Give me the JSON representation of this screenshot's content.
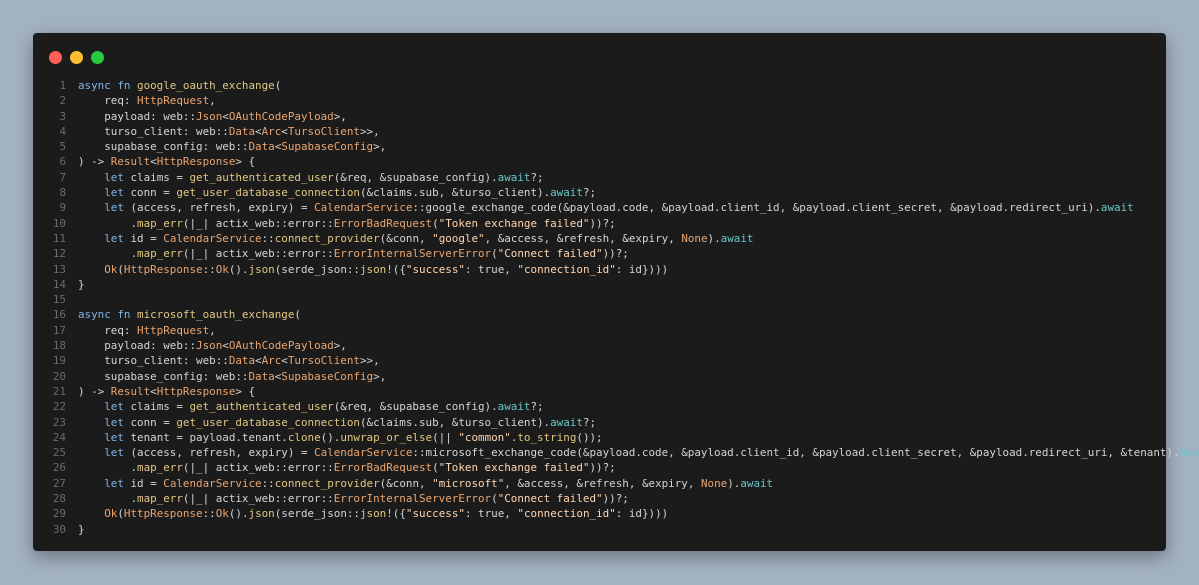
{
  "window": {
    "controls": [
      {
        "name": "close",
        "color": "#ff5f56"
      },
      {
        "name": "minimize",
        "color": "#ffbd2e"
      },
      {
        "name": "maximize",
        "color": "#27c93f"
      }
    ]
  },
  "code": {
    "lines": [
      {
        "n": "1",
        "t": [
          [
            "kw",
            "async fn "
          ],
          [
            "fn",
            "google_oauth_exchange"
          ],
          [
            "pl",
            "("
          ]
        ]
      },
      {
        "n": "2",
        "t": [
          [
            "pl",
            "    req: "
          ],
          [
            "ty",
            "HttpRequest"
          ],
          [
            "pl",
            ","
          ]
        ]
      },
      {
        "n": "3",
        "t": [
          [
            "pl",
            "    payload: web::"
          ],
          [
            "ty",
            "Json"
          ],
          [
            "pl",
            "<"
          ],
          [
            "ty",
            "OAuthCodePayload"
          ],
          [
            "pl",
            ">,"
          ]
        ]
      },
      {
        "n": "4",
        "t": [
          [
            "pl",
            "    turso_client: web::"
          ],
          [
            "ty",
            "Data"
          ],
          [
            "pl",
            "<"
          ],
          [
            "ty",
            "Arc"
          ],
          [
            "pl",
            "<"
          ],
          [
            "ty",
            "TursoClient"
          ],
          [
            "pl",
            ">>,"
          ]
        ]
      },
      {
        "n": "5",
        "t": [
          [
            "pl",
            "    supabase_config: web::"
          ],
          [
            "ty",
            "Data"
          ],
          [
            "pl",
            "<"
          ],
          [
            "ty",
            "SupabaseConfig"
          ],
          [
            "pl",
            ">,"
          ]
        ]
      },
      {
        "n": "6",
        "t": [
          [
            "pl",
            ") -> "
          ],
          [
            "ty",
            "Result"
          ],
          [
            "pl",
            "<"
          ],
          [
            "ty",
            "HttpResponse"
          ],
          [
            "pl",
            "> {"
          ]
        ]
      },
      {
        "n": "7",
        "t": [
          [
            "kw",
            "    let "
          ],
          [
            "pl",
            "claims = "
          ],
          [
            "fn",
            "get_authenticated_user"
          ],
          [
            "pl",
            "(&req, &supabase_config)."
          ],
          [
            "aw",
            "await"
          ],
          [
            "pl",
            "?;"
          ]
        ]
      },
      {
        "n": "8",
        "t": [
          [
            "kw",
            "    let "
          ],
          [
            "pl",
            "conn = "
          ],
          [
            "fn",
            "get_user_database_connection"
          ],
          [
            "pl",
            "(&claims.sub, &turso_client)."
          ],
          [
            "aw",
            "await"
          ],
          [
            "pl",
            "?;"
          ]
        ]
      },
      {
        "n": "9",
        "t": [
          [
            "kw",
            "    let "
          ],
          [
            "pl",
            "(access, refresh, expiry) = "
          ],
          [
            "ty",
            "CalendarService"
          ],
          [
            "pl",
            "::google_exchange_code(&payload.code, &payload.client_id, &payload.client_secret, &payload.redirect_uri)."
          ],
          [
            "aw",
            "await"
          ]
        ]
      },
      {
        "n": "10",
        "t": [
          [
            "pl",
            "        ."
          ],
          [
            "fn",
            "map_err"
          ],
          [
            "pl",
            "(|_| actix_web::error::"
          ],
          [
            "ty",
            "ErrorBadRequest"
          ],
          [
            "pl",
            "("
          ],
          [
            "str",
            "\"Token exchange failed\""
          ],
          [
            "pl",
            "))?;"
          ]
        ]
      },
      {
        "n": "11",
        "t": [
          [
            "kw",
            "    let "
          ],
          [
            "pl",
            "id = "
          ],
          [
            "ty",
            "CalendarService"
          ],
          [
            "pl",
            "::"
          ],
          [
            "fn",
            "connect_provider"
          ],
          [
            "pl",
            "(&conn, "
          ],
          [
            "str",
            "\"google\""
          ],
          [
            "pl",
            ", &access, &refresh, &expiry, "
          ],
          [
            "ty",
            "None"
          ],
          [
            "pl",
            ")."
          ],
          [
            "aw",
            "await"
          ]
        ]
      },
      {
        "n": "12",
        "t": [
          [
            "pl",
            "        ."
          ],
          [
            "fn",
            "map_err"
          ],
          [
            "pl",
            "(|_| actix_web::error::"
          ],
          [
            "ty",
            "ErrorInternalServerError"
          ],
          [
            "pl",
            "("
          ],
          [
            "str",
            "\"Connect failed\""
          ],
          [
            "pl",
            "))?;"
          ]
        ]
      },
      {
        "n": "13",
        "t": [
          [
            "ty",
            "    Ok"
          ],
          [
            "pl",
            "("
          ],
          [
            "ty",
            "HttpResponse"
          ],
          [
            "pl",
            "::"
          ],
          [
            "ty",
            "Ok"
          ],
          [
            "pl",
            "()."
          ],
          [
            "fn",
            "json"
          ],
          [
            "pl",
            "(serde_json::"
          ],
          [
            "fn",
            "json!"
          ],
          [
            "pl",
            "({"
          ],
          [
            "str",
            "\"success\""
          ],
          [
            "pl",
            ": true, "
          ],
          [
            "str",
            "\"connection_id\""
          ],
          [
            "pl",
            ": id})))"
          ]
        ]
      },
      {
        "n": "14",
        "t": [
          [
            "pl",
            "}"
          ]
        ]
      },
      {
        "n": "15",
        "t": [
          [
            "pl",
            ""
          ]
        ]
      },
      {
        "n": "16",
        "t": [
          [
            "kw",
            "async fn "
          ],
          [
            "fn",
            "microsoft_oauth_exchange"
          ],
          [
            "pl",
            "("
          ]
        ]
      },
      {
        "n": "17",
        "t": [
          [
            "pl",
            "    req: "
          ],
          [
            "ty",
            "HttpRequest"
          ],
          [
            "pl",
            ","
          ]
        ]
      },
      {
        "n": "18",
        "t": [
          [
            "pl",
            "    payload: web::"
          ],
          [
            "ty",
            "Json"
          ],
          [
            "pl",
            "<"
          ],
          [
            "ty",
            "OAuthCodePayload"
          ],
          [
            "pl",
            ">,"
          ]
        ]
      },
      {
        "n": "19",
        "t": [
          [
            "pl",
            "    turso_client: web::"
          ],
          [
            "ty",
            "Data"
          ],
          [
            "pl",
            "<"
          ],
          [
            "ty",
            "Arc"
          ],
          [
            "pl",
            "<"
          ],
          [
            "ty",
            "TursoClient"
          ],
          [
            "pl",
            ">>,"
          ]
        ]
      },
      {
        "n": "20",
        "t": [
          [
            "pl",
            "    supabase_config: web::"
          ],
          [
            "ty",
            "Data"
          ],
          [
            "pl",
            "<"
          ],
          [
            "ty",
            "SupabaseConfig"
          ],
          [
            "pl",
            ">,"
          ]
        ]
      },
      {
        "n": "21",
        "t": [
          [
            "pl",
            ") -> "
          ],
          [
            "ty",
            "Result"
          ],
          [
            "pl",
            "<"
          ],
          [
            "ty",
            "HttpResponse"
          ],
          [
            "pl",
            "> {"
          ]
        ]
      },
      {
        "n": "22",
        "t": [
          [
            "kw",
            "    let "
          ],
          [
            "pl",
            "claims = "
          ],
          [
            "fn",
            "get_authenticated_user"
          ],
          [
            "pl",
            "(&req, &supabase_config)."
          ],
          [
            "aw",
            "await"
          ],
          [
            "pl",
            "?;"
          ]
        ]
      },
      {
        "n": "23",
        "t": [
          [
            "kw",
            "    let "
          ],
          [
            "pl",
            "conn = "
          ],
          [
            "fn",
            "get_user_database_connection"
          ],
          [
            "pl",
            "(&claims.sub, &turso_client)."
          ],
          [
            "aw",
            "await"
          ],
          [
            "pl",
            "?;"
          ]
        ]
      },
      {
        "n": "24",
        "t": [
          [
            "kw",
            "    let "
          ],
          [
            "pl",
            "tenant = payload.tenant."
          ],
          [
            "fn",
            "clone"
          ],
          [
            "pl",
            "()."
          ],
          [
            "fn",
            "unwrap_or_else"
          ],
          [
            "pl",
            "(|| "
          ],
          [
            "str",
            "\"common\""
          ],
          [
            "pl",
            "."
          ],
          [
            "fn",
            "to_string"
          ],
          [
            "pl",
            "());"
          ]
        ]
      },
      {
        "n": "25",
        "t": [
          [
            "kw",
            "    let "
          ],
          [
            "pl",
            "(access, refresh, expiry) = "
          ],
          [
            "ty",
            "CalendarService"
          ],
          [
            "pl",
            "::microsoft_exchange_code(&payload.code, &payload.client_id, &payload.client_secret, &payload.redirect_uri, &tenant)."
          ],
          [
            "aw",
            "await"
          ]
        ]
      },
      {
        "n": "26",
        "t": [
          [
            "pl",
            "        ."
          ],
          [
            "fn",
            "map_err"
          ],
          [
            "pl",
            "(|_| actix_web::error::"
          ],
          [
            "ty",
            "ErrorBadRequest"
          ],
          [
            "pl",
            "("
          ],
          [
            "str",
            "\"Token exchange failed\""
          ],
          [
            "pl",
            "))?;"
          ]
        ]
      },
      {
        "n": "27",
        "t": [
          [
            "kw",
            "    let "
          ],
          [
            "pl",
            "id = "
          ],
          [
            "ty",
            "CalendarService"
          ],
          [
            "pl",
            "::"
          ],
          [
            "fn",
            "connect_provider"
          ],
          [
            "pl",
            "(&conn, "
          ],
          [
            "str",
            "\"microsoft\""
          ],
          [
            "pl",
            ", &access, &refresh, &expiry, "
          ],
          [
            "ty",
            "None"
          ],
          [
            "pl",
            ")."
          ],
          [
            "aw",
            "await"
          ]
        ]
      },
      {
        "n": "28",
        "t": [
          [
            "pl",
            "        ."
          ],
          [
            "fn",
            "map_err"
          ],
          [
            "pl",
            "(|_| actix_web::error::"
          ],
          [
            "ty",
            "ErrorInternalServerError"
          ],
          [
            "pl",
            "("
          ],
          [
            "str",
            "\"Connect failed\""
          ],
          [
            "pl",
            "))?;"
          ]
        ]
      },
      {
        "n": "29",
        "t": [
          [
            "ty",
            "    Ok"
          ],
          [
            "pl",
            "("
          ],
          [
            "ty",
            "HttpResponse"
          ],
          [
            "pl",
            "::"
          ],
          [
            "ty",
            "Ok"
          ],
          [
            "pl",
            "()."
          ],
          [
            "fn",
            "json"
          ],
          [
            "pl",
            "(serde_json::"
          ],
          [
            "fn",
            "json!"
          ],
          [
            "pl",
            "({"
          ],
          [
            "str",
            "\"success\""
          ],
          [
            "pl",
            ": true, "
          ],
          [
            "str",
            "\"connection_id\""
          ],
          [
            "pl",
            ": id})))"
          ]
        ]
      },
      {
        "n": "30",
        "t": [
          [
            "pl",
            "}"
          ]
        ]
      }
    ]
  }
}
